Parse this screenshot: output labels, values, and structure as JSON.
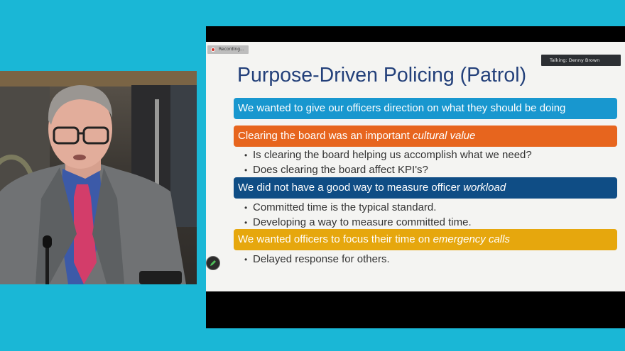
{
  "screen_share": {
    "recording_label": "Recording...",
    "talking_label": "Talking: Denny Brown"
  },
  "slide": {
    "title": "Purpose-Driven Policing (Patrol)",
    "sections": [
      {
        "color": "#1897cf",
        "text": "We wanted to give our officers direction on what they should be doing",
        "emphasis": "",
        "bullets": []
      },
      {
        "color": "#e7651e",
        "text": "Clearing the board was an important ",
        "emphasis": "cultural value",
        "bullets": [
          "Is clearing the board helping us accomplish what we need?",
          "Does clearing the board affect KPI's?"
        ]
      },
      {
        "color": "#0f4d85",
        "text": "We did not have a good way to measure officer ",
        "emphasis": "workload",
        "bullets": [
          "Committed time is the typical standard.",
          "Developing a way to measure committed time."
        ]
      },
      {
        "color": "#e6a70d",
        "text": "We wanted officers to focus their time on ",
        "emphasis": "emergency calls",
        "bullets": [
          "Delayed response for others."
        ]
      }
    ]
  },
  "icons": {
    "recording": "record-dot-icon",
    "annotate": "pencil-icon"
  }
}
